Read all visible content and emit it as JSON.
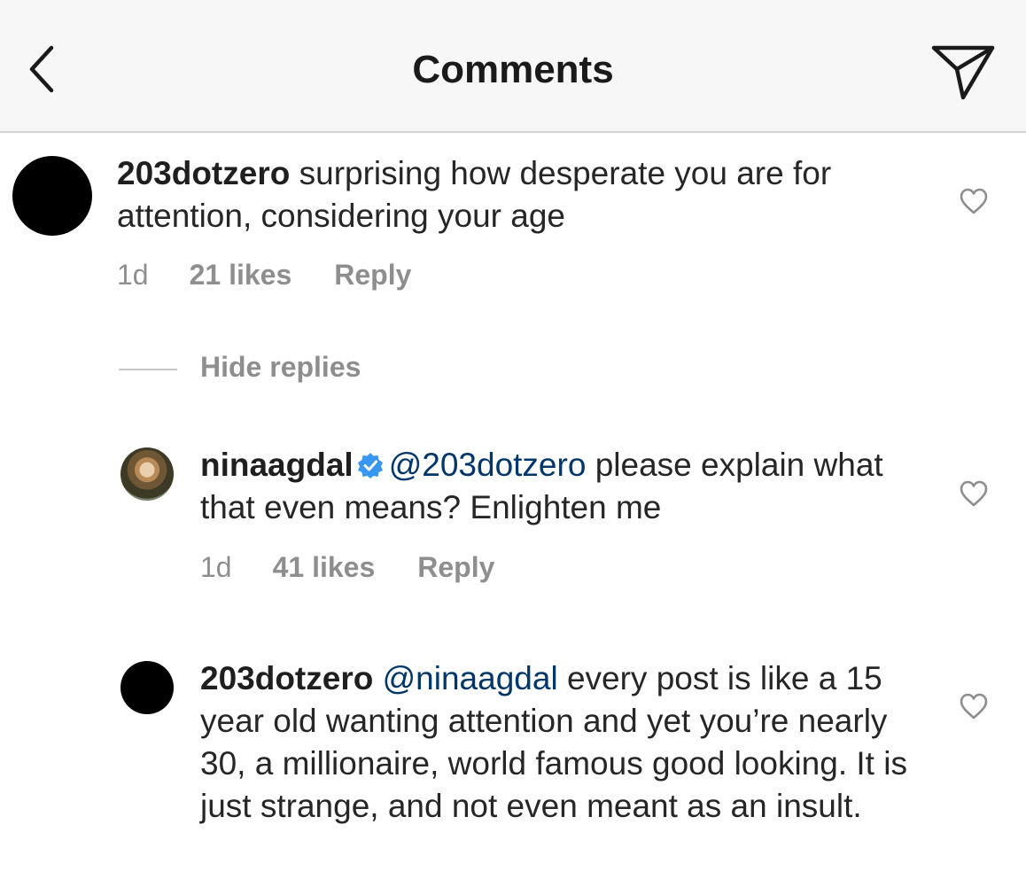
{
  "header": {
    "title": "Comments",
    "back_icon": "chevron-left-icon",
    "send_icon": "paper-plane-icon"
  },
  "comments": [
    {
      "username": "203dotzero",
      "mention": "",
      "text": " surprising how desperate you are for attention, considering your age",
      "time": "1d",
      "likes": "21 likes",
      "reply": "Reply"
    }
  ],
  "hide_replies": "Hide replies",
  "replies": [
    {
      "username": "ninaagdal",
      "verified": true,
      "mention": "@203dotzero",
      "text": " please explain what that even means? Enlighten me",
      "time": "1d",
      "likes": "41 likes",
      "reply": "Reply"
    },
    {
      "username": "203dotzero",
      "mention": "@ninaagdal",
      "text": " every post is like a 15 year old wanting attention and yet you’re nearly 30, a millionaire, world famous good looking. It is just strange, and not even meant as an insult."
    }
  ],
  "colors": {
    "text": "#262626",
    "muted": "#8e8e8e",
    "mention": "#00376b",
    "verified": "#3897f0",
    "header_bg": "#f7f7f7"
  }
}
